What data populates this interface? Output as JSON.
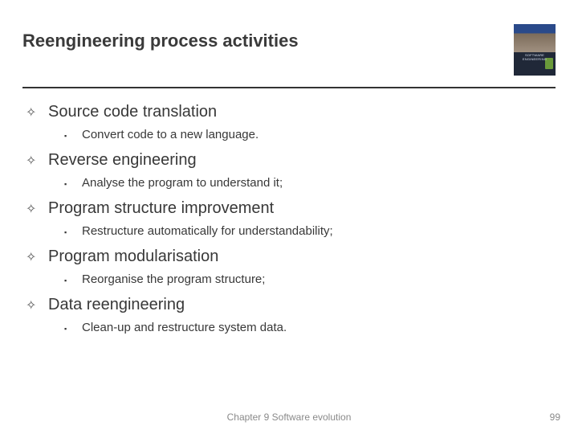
{
  "title": "Reengineering process activities",
  "items": [
    {
      "heading": "Source code translation",
      "sub": "Convert code to a new language."
    },
    {
      "heading": "Reverse engineering",
      "sub": "Analyse the program to understand it;"
    },
    {
      "heading": "Program structure improvement",
      "sub": "Restructure automatically for understandability;"
    },
    {
      "heading": "Program modularisation",
      "sub": "Reorganise the program structure;"
    },
    {
      "heading": "Data reengineering",
      "sub": "Clean-up and restructure system data."
    }
  ],
  "footer": "Chapter 9 Software evolution",
  "page_number": "99",
  "bullets": {
    "lvl1": "✧",
    "lvl2": "▪"
  }
}
